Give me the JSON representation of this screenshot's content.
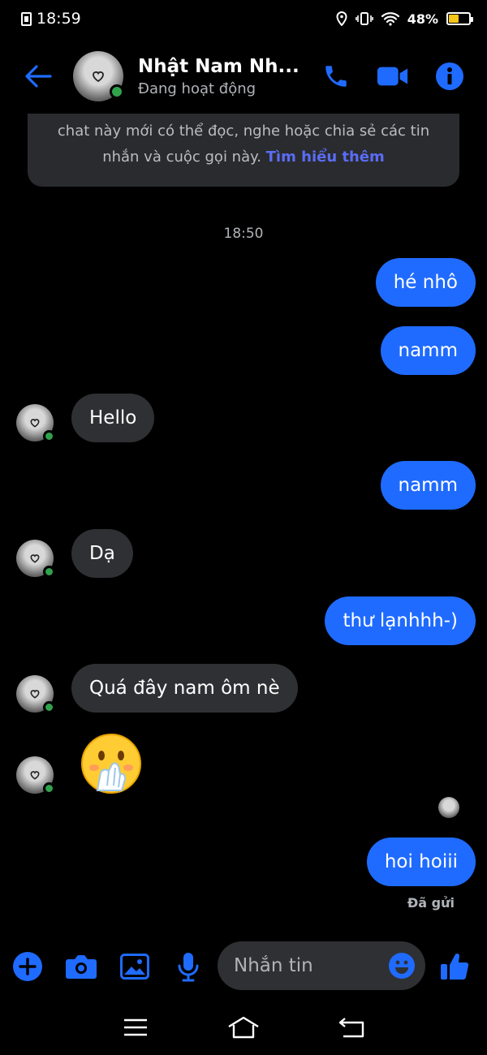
{
  "status_bar": {
    "time": "18:59",
    "battery": "48%",
    "battery_level": 0.48
  },
  "header": {
    "contact_name": "Nhật Nam Nh...",
    "contact_status": "Đang hoạt động"
  },
  "notice": {
    "line1": "chat này mới có thể đọc, nghe hoặc chia sẻ các tin",
    "line2": "nhắn và cuộc gọi này.",
    "link": "Tìm hiểu thêm"
  },
  "timestamp": "18:50",
  "messages": [
    {
      "side": "sent",
      "text": "hé nhô"
    },
    {
      "side": "sent",
      "text": "namm"
    },
    {
      "side": "received",
      "text": "Hello"
    },
    {
      "side": "sent",
      "text": "namm"
    },
    {
      "side": "received",
      "text": "Dạ"
    },
    {
      "side": "sent",
      "text": "thư lạnhhh-)"
    },
    {
      "side": "received",
      "text": "Quá đây nam ôm nè"
    },
    {
      "side": "received",
      "emoji": "face-with-hand-over-mouth"
    },
    {
      "side": "sent",
      "text": "hoi hoiii"
    }
  ],
  "sent_status": "Đã gửi",
  "composer": {
    "placeholder": "Nhắn tin"
  },
  "colors": {
    "accent": "#1f6bff",
    "received_bubble": "#2f3033",
    "online": "#31a24c",
    "link": "#5a6cf5"
  }
}
